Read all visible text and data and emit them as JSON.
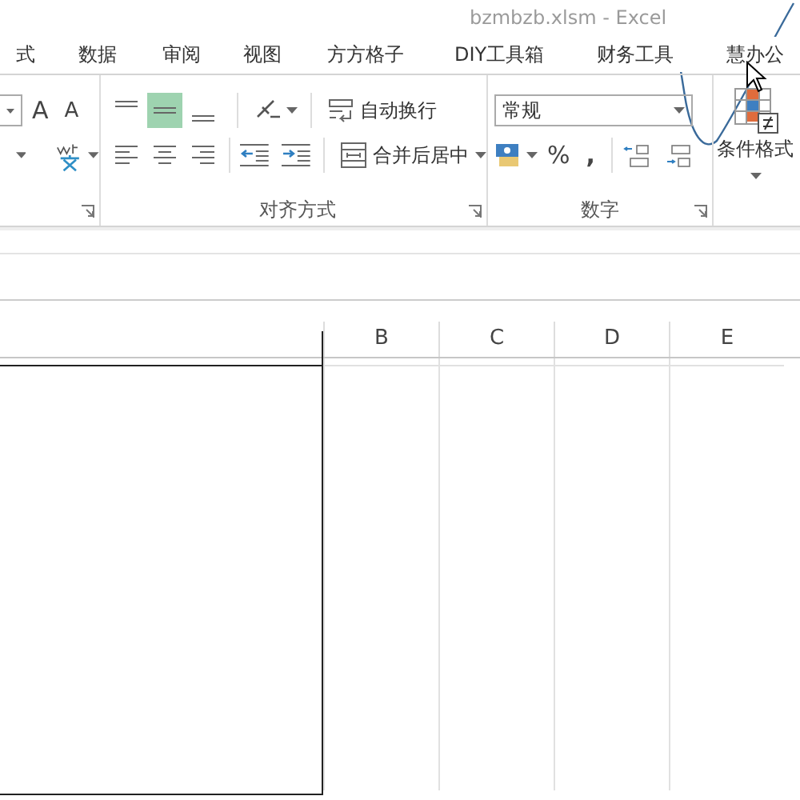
{
  "window": {
    "title": "bzmbzb.xlsm - Excel"
  },
  "tabs": [
    {
      "label": "式",
      "selected": false
    },
    {
      "label": "数据",
      "selected": false
    },
    {
      "label": "审阅",
      "selected": false
    },
    {
      "label": "视图",
      "selected": false
    },
    {
      "label": "方方格子",
      "selected": false
    },
    {
      "label": "DIY工具箱",
      "selected": false
    },
    {
      "label": "财务工具",
      "selected": false
    },
    {
      "label": "慧办公",
      "selected": false
    }
  ],
  "font_group": {
    "grow_label": "A",
    "shrink_label": "A"
  },
  "alignment_group": {
    "label": "对齐方式",
    "vertical_align": [
      {
        "kind": "top",
        "selected": false
      },
      {
        "kind": "middle",
        "selected": true
      },
      {
        "kind": "bottom",
        "selected": false
      }
    ],
    "wrap_text": "自动换行",
    "merge_center": "合并后居中"
  },
  "number_group": {
    "label": "数字",
    "format": "常规",
    "percent": "%",
    "comma": ","
  },
  "styles_group": {
    "conditional_format": "条件格式"
  },
  "columns": [
    "B",
    "C",
    "D",
    "E"
  ]
}
